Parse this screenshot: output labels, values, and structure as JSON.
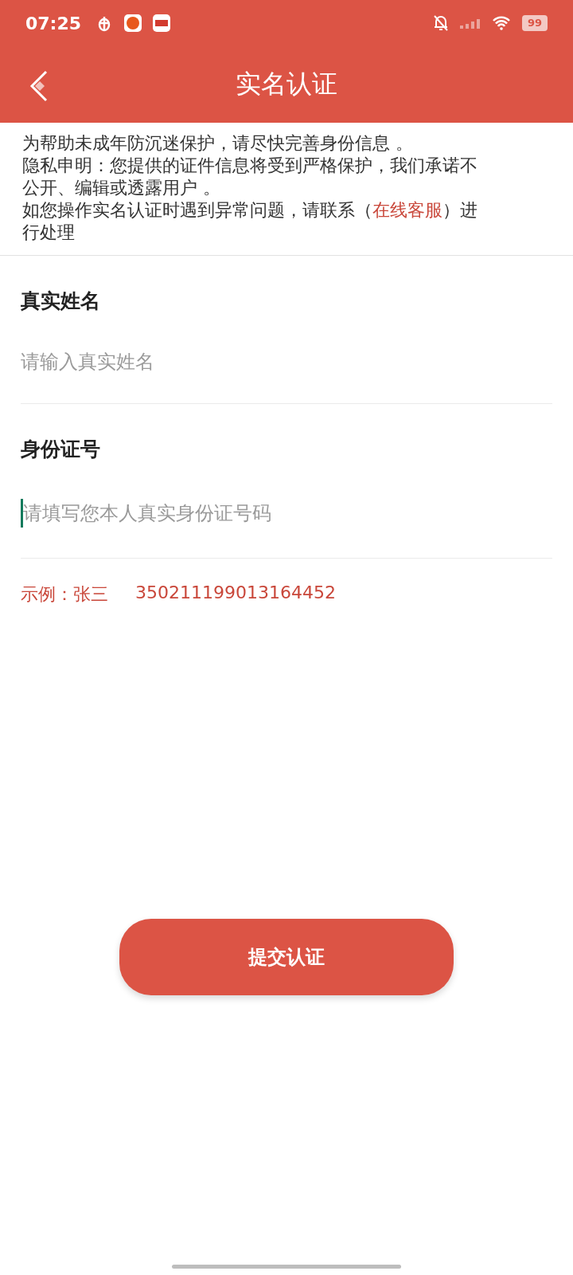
{
  "status_bar": {
    "time": "07:25",
    "battery": "99"
  },
  "header": {
    "title": "实名认证"
  },
  "notice": {
    "lines": [
      "为帮助未成年防沉迷保护，请尽快完善身份信息 。",
      "隐私申明：您提供的证件信息将受到严格保护，我们承诺不公开、编辑或透露用户 。"
    ],
    "contact": {
      "before": "如您操作实名认证时遇到异常问题，请联系（",
      "link": "在线客服",
      "after": "）进行处理"
    }
  },
  "fields": [
    {
      "label": "真实姓名",
      "placeholder": "请输入真实姓名",
      "focused": false
    },
    {
      "label": "身份证号",
      "placeholder": "请填写您本人真实身份证号码",
      "focused": true
    }
  ],
  "example": {
    "label": "示例：张三",
    "number": "350211199013164452"
  },
  "submit_button": "提交认证"
}
